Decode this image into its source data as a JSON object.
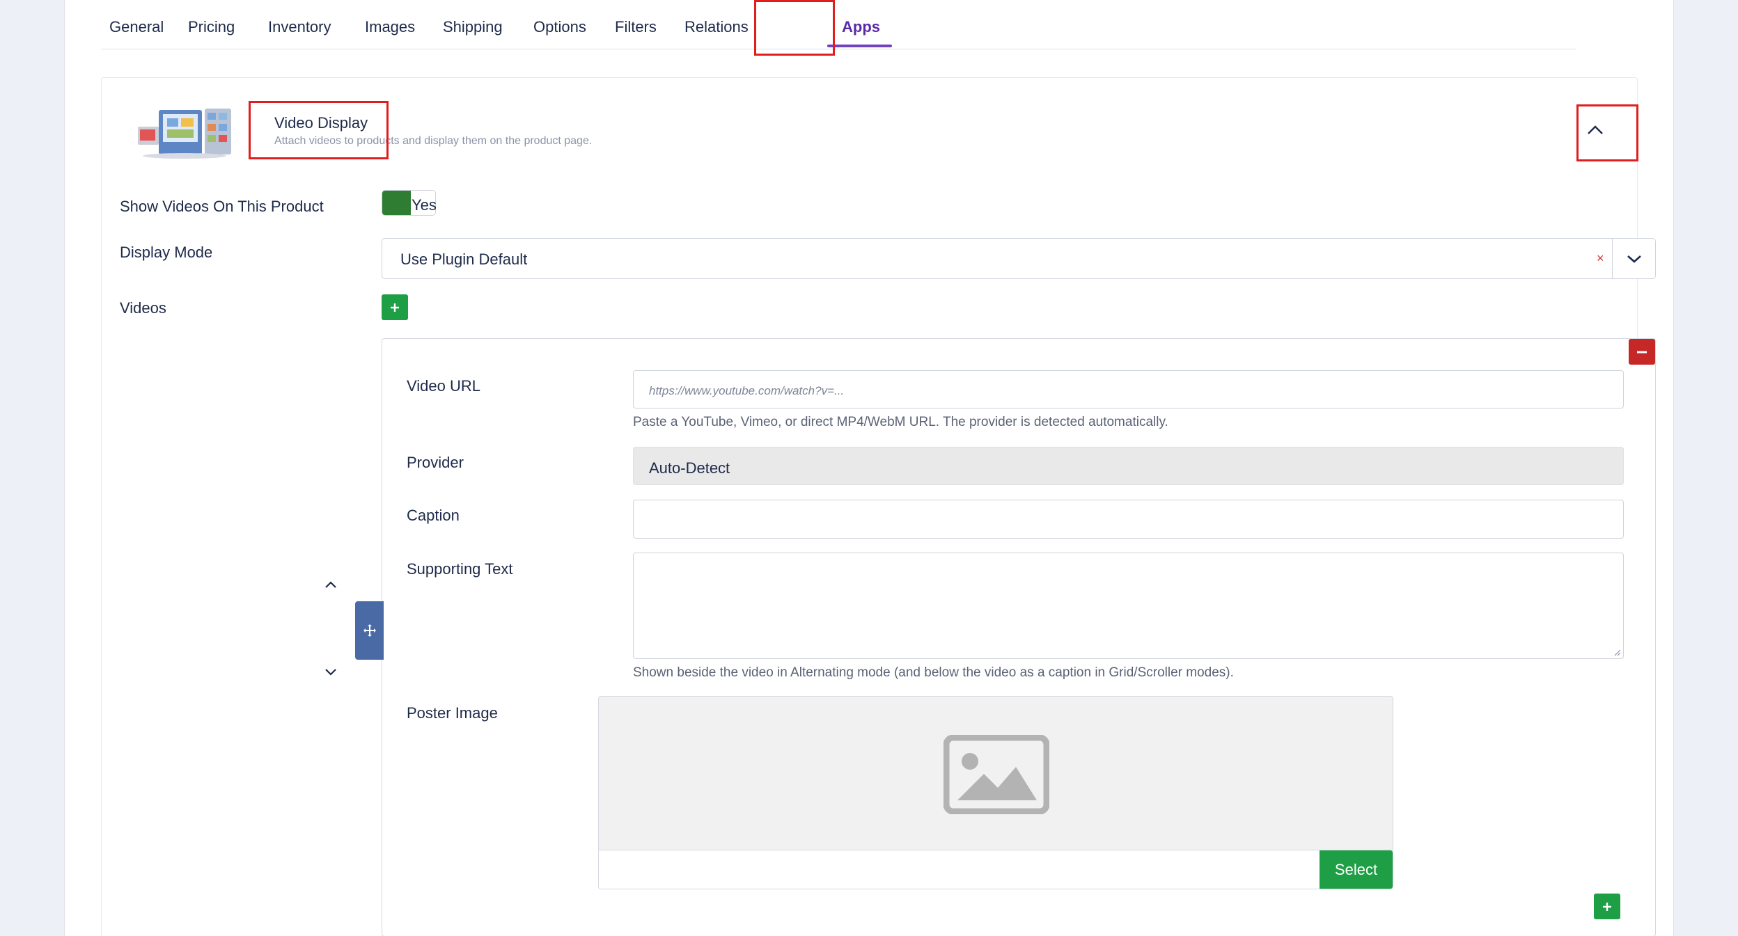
{
  "tabs": [
    {
      "label": "General"
    },
    {
      "label": "Pricing"
    },
    {
      "label": "Inventory"
    },
    {
      "label": "Images"
    },
    {
      "label": "Shipping"
    },
    {
      "label": "Options"
    },
    {
      "label": "Filters"
    },
    {
      "label": "Relations"
    },
    {
      "label": "Apps",
      "active": true
    }
  ],
  "app": {
    "title": "Video Display",
    "subtitle": "Attach videos to products and display them on the product page.",
    "icon": "video-gallery-icon"
  },
  "fields": {
    "show_videos": {
      "label": "Show Videos On This Product",
      "value": "Yes",
      "enabled": true
    },
    "display_mode": {
      "label": "Display Mode",
      "value": "Use Plugin Default",
      "clear": "×"
    },
    "videos": {
      "label": "Videos"
    }
  },
  "video_item": {
    "url": {
      "label": "Video URL",
      "placeholder": "https://www.youtube.com/watch?v=...",
      "help": "Paste a YouTube, Vimeo, or direct MP4/WebM URL. The provider is detected automatically."
    },
    "provider": {
      "label": "Provider",
      "value": "Auto-Detect"
    },
    "caption": {
      "label": "Caption",
      "value": ""
    },
    "supporting_text": {
      "label": "Supporting Text",
      "value": "",
      "help": "Shown beside the video in Alternating mode (and below the video as a caption in Grid/Scroller modes)."
    },
    "poster": {
      "label": "Poster Image",
      "select_label": "Select",
      "icon": "image-placeholder-icon"
    }
  },
  "colors": {
    "accent": "#6f42c1",
    "success": "#1e9e45",
    "danger": "#c62828",
    "highlight": "#e01e1e",
    "drag": "#4a6aa5"
  }
}
